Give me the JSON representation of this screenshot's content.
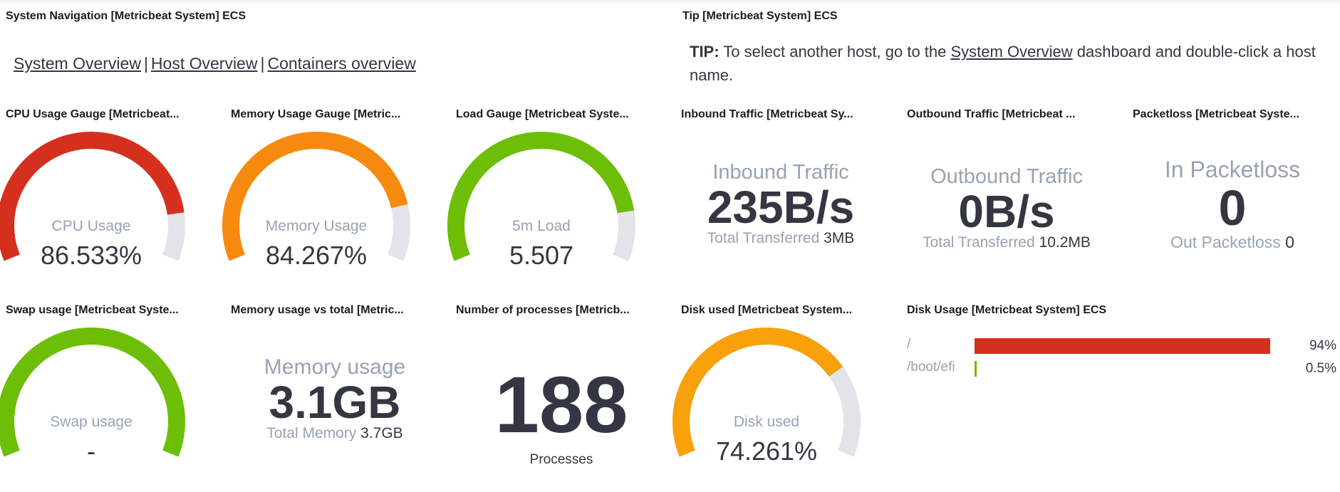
{
  "nav_panel": {
    "title": "System Navigation [Metricbeat System] ECS",
    "links": [
      "System Overview",
      "Host Overview",
      "Containers overview"
    ],
    "separator": "|"
  },
  "tip_panel": {
    "title": "Tip [Metricbeat System] ECS",
    "tip_label": "TIP:",
    "tip_before": " To select another host, go to the ",
    "tip_link": "System Overview",
    "tip_after": " dashboard and double-click a host name."
  },
  "cpu_gauge": {
    "title": "CPU Usage Gauge [Metricbeat...",
    "label": "CPU Usage",
    "value": "86.533%",
    "fraction": 0.86533,
    "color": "#d4301d"
  },
  "memory_gauge": {
    "title": "Memory Usage Gauge [Metric...",
    "label": "Memory Usage",
    "value": "84.267%",
    "fraction": 0.84267,
    "color": "#f68a0f"
  },
  "load_gauge": {
    "title": "Load Gauge [Metricbeat Syste...",
    "label": "5m Load",
    "value": "5.507",
    "fraction": 0.86,
    "color": "#6dbe06"
  },
  "inbound": {
    "title": "Inbound Traffic [Metricbeat Sy...",
    "metric_title": "Inbound Traffic",
    "value": "235B/s",
    "sub_label": "Total Transferred",
    "sub_value": "3MB"
  },
  "outbound": {
    "title": "Outbound Traffic [Metricbeat ...",
    "metric_title": "Outbound Traffic",
    "value": "0B/s",
    "sub_label": "Total Transferred",
    "sub_value": "10.2MB"
  },
  "packetloss": {
    "title": "Packetloss [Metricbeat Syste...",
    "metric_title": "In Packetloss",
    "value": "0",
    "sub_label": "Out Packetloss",
    "sub_value": "0"
  },
  "swap_gauge": {
    "title": "Swap usage [Metricbeat Syste...",
    "label": "Swap usage",
    "value": "-",
    "fraction": 1.0,
    "color": "#6dbe06"
  },
  "memory_total": {
    "title": "Memory usage vs total [Metric...",
    "metric_title": "Memory usage",
    "value": "3.1GB",
    "sub_label": "Total Memory",
    "sub_value": "3.7GB"
  },
  "processes": {
    "title": "Number of processes [Metricb...",
    "value": "188",
    "label": "Processes"
  },
  "disk_gauge": {
    "title": "Disk used [Metricbeat System...",
    "label": "Disk used",
    "value": "74.261%",
    "fraction": 0.74261,
    "color": "#f8a10b"
  },
  "disk_usage": {
    "title": "Disk Usage [Metricbeat System] ECS",
    "rows": [
      {
        "label": "/",
        "percent": "94%",
        "fraction": 0.94,
        "color": "#d4301d"
      },
      {
        "label": "/boot/efi",
        "percent": "0.5%",
        "fraction": 0.005,
        "color": "#6dbe06"
      }
    ]
  },
  "colors": {
    "gauge_track": "#e3e4e8",
    "text": "#343741",
    "muted": "#98a2b3"
  }
}
